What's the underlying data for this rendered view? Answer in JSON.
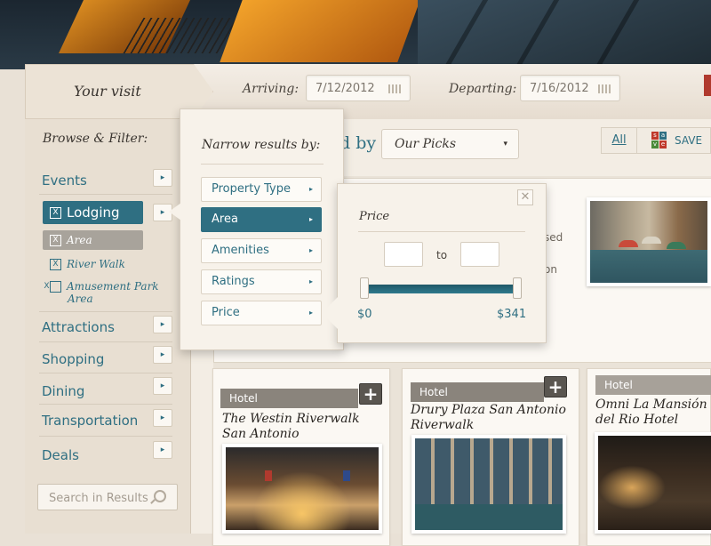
{
  "visit": {
    "label": "Your visit",
    "arriving_label": "Arriving:",
    "arriving_value": "7/12/2012",
    "departing_label": "Departing:",
    "departing_value": "7/16/2012"
  },
  "sidebar": {
    "title": "Browse & Filter:",
    "categories": [
      {
        "label": "Events"
      },
      {
        "label": "Lodging"
      },
      {
        "label": "Attractions"
      },
      {
        "label": "Shopping"
      },
      {
        "label": "Dining"
      },
      {
        "label": "Transportation"
      },
      {
        "label": "Deals"
      }
    ],
    "active_filters": [
      {
        "label": "Area"
      },
      {
        "label": "River Walk"
      },
      {
        "label": "Amusement Park Area"
      }
    ],
    "search_placeholder": "Search in Results",
    "remove_glyph": "X"
  },
  "sort": {
    "by_label": "d by",
    "selected": "Our Picks"
  },
  "toolbar": {
    "view_all": "All",
    "save_label": "SAVE",
    "save_icon_letters": [
      "s",
      "a",
      "v",
      "e"
    ]
  },
  "narrow": {
    "title": "Narrow results by:",
    "items": [
      {
        "label": "Property Type"
      },
      {
        "label": "Area"
      },
      {
        "label": "Amenities"
      },
      {
        "label": "Ratings"
      },
      {
        "label": "Price"
      }
    ],
    "active_index": 1
  },
  "price": {
    "title": "Price",
    "to_label": "to",
    "min_label": "$0",
    "max_label": "$341",
    "close_glyph": "✕"
  },
  "featured": {
    "partial_lines": [
      "sed",
      "on"
    ]
  },
  "hotels": [
    {
      "tag": "Hotel",
      "name_line1": "The Westin Riverwalk",
      "name_line2": "San Antonio"
    },
    {
      "tag": "Hotel",
      "name_line1": "Drury Plaza San Antonio",
      "name_line2": "Riverwalk"
    },
    {
      "tag": "Hotel",
      "name_line1": "Omni La Mansión",
      "name_line2": "del Rio Hotel"
    }
  ],
  "glyphs": {
    "arrow": "▸",
    "plus": "+",
    "caret": "▾"
  },
  "colors": {
    "accent_teal": "#2f6f82",
    "panel_bg": "#f3ede4",
    "tag_gray": "#8a847c",
    "save_red": "#c0392b",
    "save_blue": "#2f6f82",
    "save_green": "#4a8a3a"
  },
  "icons": [
    "calendar-icon",
    "arrow-right-icon",
    "remove-filter-icon",
    "search-icon",
    "dropdown-caret-icon",
    "save-icon",
    "close-icon",
    "plus-icon"
  ]
}
